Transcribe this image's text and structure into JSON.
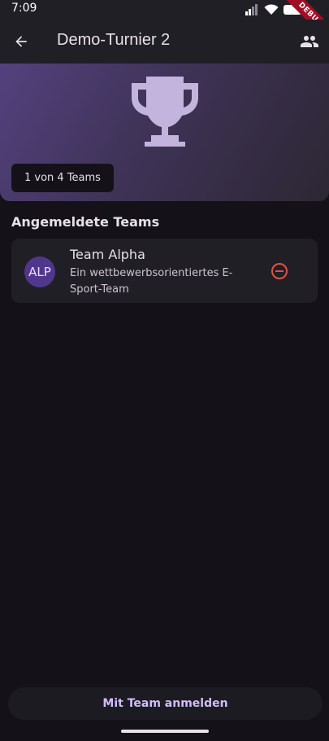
{
  "status_bar": {
    "time": "7:09",
    "icons": [
      "signal-icon",
      "wifi-icon",
      "battery-icon"
    ],
    "debug_label": "DEBUG"
  },
  "app_bar": {
    "title": "Demo-Turnier 2",
    "back_icon": "arrow-left-icon",
    "action_icon": "people-icon"
  },
  "hero": {
    "icon": "trophy-icon",
    "count_label": "1 von 4 Teams"
  },
  "section": {
    "title": "Angemeldete Teams"
  },
  "teams": [
    {
      "avatar": "ALP",
      "name": "Team Alpha",
      "description": "Ein wettbewerbsorientiertes E-Sport-Team",
      "action_icon": "remove-circle-icon"
    }
  ],
  "footer": {
    "register_label": "Mit Team anmelden"
  },
  "colors": {
    "background": "#141218",
    "surface": "#211f26",
    "accent": "#d0bcff",
    "remove": "#e0533f"
  }
}
